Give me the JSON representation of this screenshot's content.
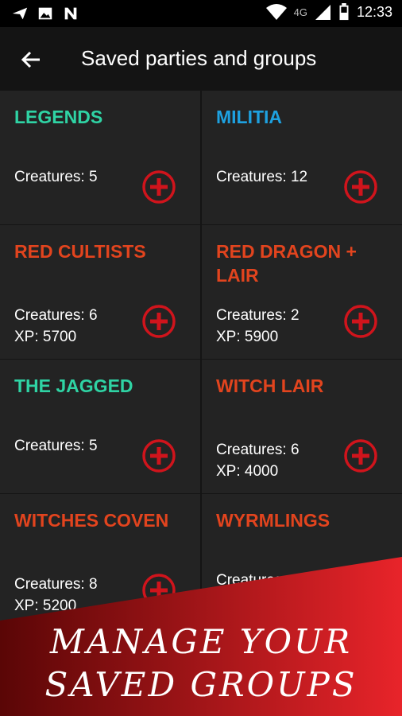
{
  "status_bar": {
    "time": "12:33",
    "network": "4G",
    "icons": [
      "send-icon",
      "image-icon",
      "n-app-icon",
      "wifi-icon",
      "signal-icon",
      "battery-icon"
    ]
  },
  "toolbar": {
    "title": "Saved parties and groups",
    "back_icon": "arrow-back-icon"
  },
  "groups": [
    {
      "name": "LEGENDS",
      "color": "#2fd3a4",
      "creatures": "Creatures: 5",
      "xp": ""
    },
    {
      "name": "MILITIA",
      "color": "#1ea1e0",
      "creatures": "Creatures: 12",
      "xp": ""
    },
    {
      "name": "RED CULTISTS",
      "color": "#e2441e",
      "creatures": "Creatures: 6",
      "xp": "XP: 5700"
    },
    {
      "name": "RED DRAGON + LAIR",
      "color": "#e2441e",
      "creatures": "Creatures: 2",
      "xp": "XP: 5900"
    },
    {
      "name": "THE JAGGED",
      "color": "#2fd3a4",
      "creatures": "Creatures: 5",
      "xp": ""
    },
    {
      "name": "WITCH LAIR",
      "color": "#e2441e",
      "creatures": "Creatures: 6",
      "xp": "XP: 4000"
    },
    {
      "name": "WITCHES COVEN",
      "color": "#e2441e",
      "creatures": "Creatures: 8",
      "xp": "XP: 5200"
    },
    {
      "name": "WYRMLINGS",
      "color": "#e2441e",
      "creatures": "Creatures:",
      "xp": ""
    }
  ],
  "colors": {
    "add_button": "#d0141c",
    "card_bg": "#232323",
    "banner_dark": "#5a0606",
    "banner_light": "#e8242a"
  },
  "banner": {
    "line1": "MANAGE YOUR",
    "line2": "SAVED GROUPS"
  }
}
